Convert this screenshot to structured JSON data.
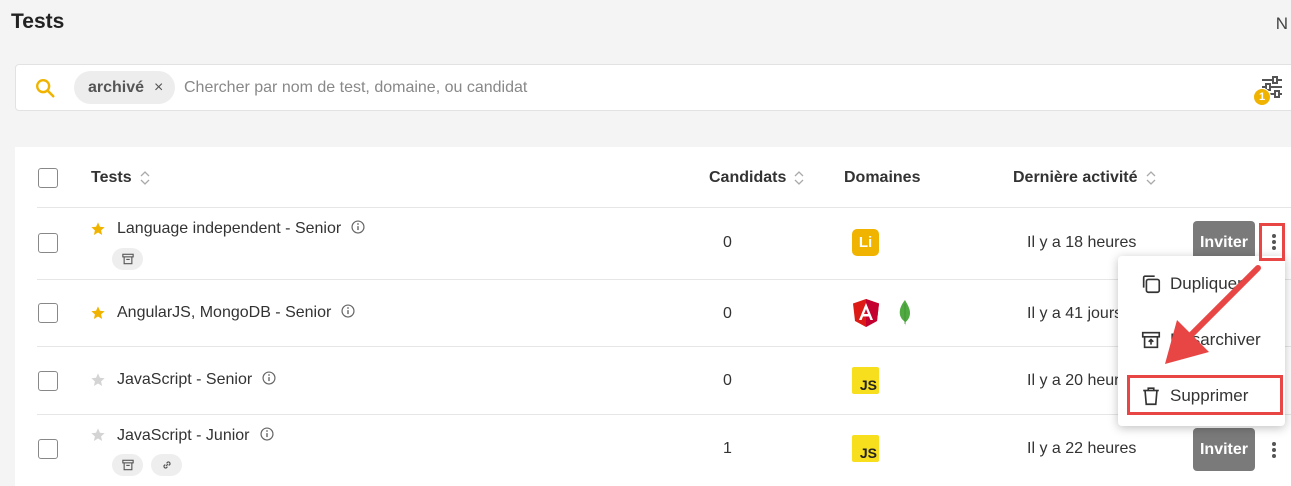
{
  "page": {
    "title": "Tests",
    "top_right_letter": "N"
  },
  "search": {
    "chip_label": "archivé",
    "chip_close": "×",
    "placeholder": "Chercher par nom de test, domaine, ou candidat",
    "value": "",
    "filter_count": "1"
  },
  "table": {
    "headers": {
      "tests": "Tests",
      "candidates": "Candidats",
      "domains": "Domaines",
      "activity": "Dernière activité"
    },
    "rows": [
      {
        "name": "Language independent - Senior",
        "starred": true,
        "candidates": "0",
        "activity": "Il y a 18 heures",
        "domains": [
          "Li"
        ],
        "invite": "Inviter"
      },
      {
        "name": "AngularJS, MongoDB - Senior",
        "starred": true,
        "candidates": "0",
        "activity": "Il y a 41 jours",
        "domains": [
          "angular-icon",
          "mongodb-icon"
        ]
      },
      {
        "name": "JavaScript - Senior",
        "starred": false,
        "candidates": "0",
        "activity": "Il y a 20 heures",
        "domains": [
          "JS"
        ]
      },
      {
        "name": "JavaScript - Junior",
        "starred": false,
        "candidates": "1",
        "activity": "Il y a 22 heures",
        "domains": [
          "JS"
        ],
        "invite": "Inviter"
      }
    ]
  },
  "menu": {
    "items": [
      {
        "label": "Dupliquer",
        "icon": "copy-icon"
      },
      {
        "label": "Désarchiver",
        "icon": "unarchive-icon"
      },
      {
        "label": "Supprimer",
        "icon": "trash-icon"
      }
    ]
  },
  "colors": {
    "accent_yellow": "#f0b400",
    "invite_button": "#7a7a7a",
    "highlight_red": "#e84545",
    "js_yellow": "#f7df1e",
    "angular_red": "#dd1b16",
    "mongo_green": "#4faa41"
  }
}
